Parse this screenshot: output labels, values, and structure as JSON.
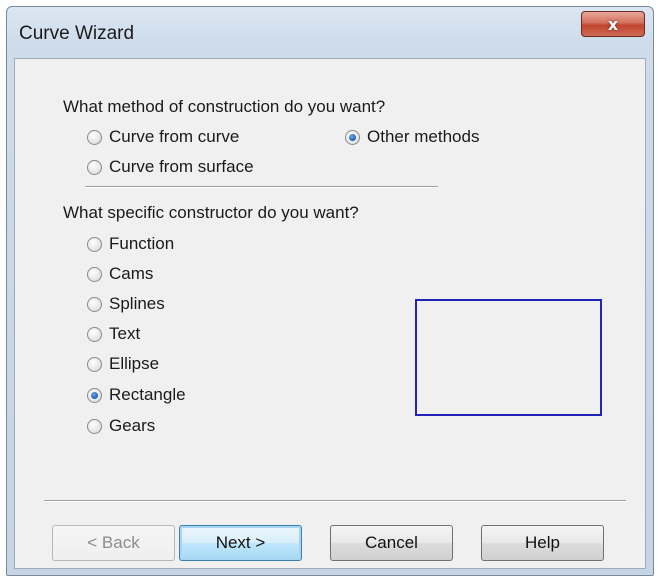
{
  "window": {
    "title": "Curve Wizard",
    "close_glyph": "x"
  },
  "method": {
    "question": "What method of construction do you want?",
    "options": [
      {
        "label": "Curve from curve",
        "checked": false
      },
      {
        "label": "Other methods",
        "checked": true
      },
      {
        "label": "Curve from surface",
        "checked": false
      }
    ]
  },
  "constructor": {
    "question": "What specific constructor do you want?",
    "options": [
      {
        "label": "Function",
        "checked": false
      },
      {
        "label": "Cams",
        "checked": false
      },
      {
        "label": "Splines",
        "checked": false
      },
      {
        "label": "Text",
        "checked": false
      },
      {
        "label": "Ellipse",
        "checked": false
      },
      {
        "label": "Rectangle",
        "checked": true
      },
      {
        "label": "Gears",
        "checked": false
      }
    ]
  },
  "buttons": {
    "back": "< Back",
    "next": "Next >",
    "cancel": "Cancel",
    "help": "Help"
  },
  "colors": {
    "preview_stroke": "#2323b8",
    "radio_checked": "#1d5fb7",
    "close_button": "#c0452f"
  }
}
